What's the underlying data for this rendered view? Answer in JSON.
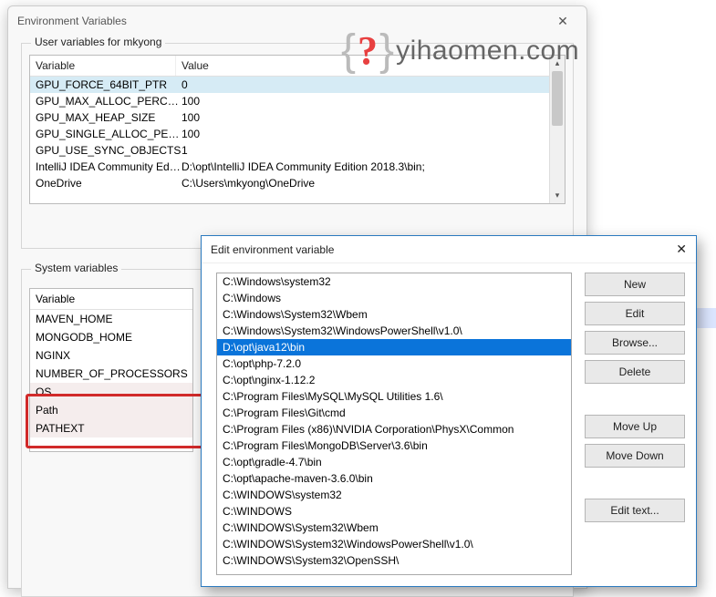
{
  "watermark": {
    "question": "?",
    "domain": "yihaomen.com"
  },
  "win1": {
    "title": "Environment Variables",
    "userGroupLabel": "User variables for mkyong",
    "sysGroupLabel": "System variables",
    "colVar": "Variable",
    "colVal": "Value",
    "userRows": [
      {
        "k": "GPU_FORCE_64BIT_PTR",
        "v": "0",
        "sel": true
      },
      {
        "k": "GPU_MAX_ALLOC_PERCENT",
        "v": "100"
      },
      {
        "k": "GPU_MAX_HEAP_SIZE",
        "v": "100"
      },
      {
        "k": "GPU_SINGLE_ALLOC_PERCE...",
        "v": "100"
      },
      {
        "k": "GPU_USE_SYNC_OBJECTS",
        "v": "1"
      },
      {
        "k": "IntelliJ IDEA Community Edit...",
        "v": "D:\\opt\\IntelliJ IDEA Community Edition 2018.3\\bin;"
      },
      {
        "k": "OneDrive",
        "v": "C:\\Users\\mkyong\\OneDrive"
      }
    ],
    "sysRows": [
      {
        "k": "MAVEN_HOME"
      },
      {
        "k": "MONGODB_HOME"
      },
      {
        "k": "NGINX"
      },
      {
        "k": "NUMBER_OF_PROCESSORS"
      },
      {
        "k": "OS",
        "hi": true
      },
      {
        "k": "Path",
        "hi": true
      },
      {
        "k": "PATHEXT",
        "hi": true
      }
    ]
  },
  "win2": {
    "title": "Edit environment variable",
    "entries": [
      "C:\\Windows\\system32",
      "C:\\Windows",
      "C:\\Windows\\System32\\Wbem",
      "C:\\Windows\\System32\\WindowsPowerShell\\v1.0\\",
      "D:\\opt\\java12\\bin",
      "C:\\opt\\php-7.2.0",
      "C:\\opt\\nginx-1.12.2",
      "C:\\Program Files\\MySQL\\MySQL Utilities 1.6\\",
      "C:\\Program Files\\Git\\cmd",
      "C:\\Program Files (x86)\\NVIDIA Corporation\\PhysX\\Common",
      "C:\\Program Files\\MongoDB\\Server\\3.6\\bin",
      "C:\\opt\\gradle-4.7\\bin",
      "C:\\opt\\apache-maven-3.6.0\\bin",
      "C:\\WINDOWS\\system32",
      "C:\\WINDOWS",
      "C:\\WINDOWS\\System32\\Wbem",
      "C:\\WINDOWS\\System32\\WindowsPowerShell\\v1.0\\",
      "C:\\WINDOWS\\System32\\OpenSSH\\"
    ],
    "selectedIndex": 4,
    "buttons": {
      "new": "New",
      "edit": "Edit",
      "browse": "Browse...",
      "delete": "Delete",
      "moveUp": "Move Up",
      "moveDown": "Move Down",
      "editText": "Edit text..."
    }
  }
}
